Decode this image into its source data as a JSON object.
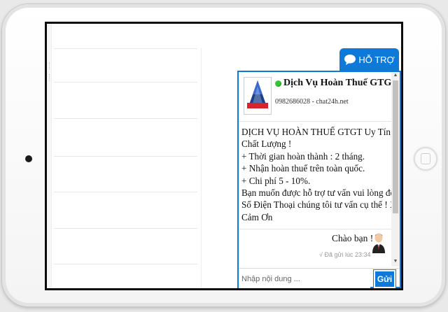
{
  "chat_widget": {
    "tab_label": "HỖ TRỢ",
    "agent": {
      "name": "Dịch Vụ Hoàn Thuế GTGT",
      "phone_line": "0982686028 - chat24h.net",
      "status": "online",
      "status_color": "#32c832"
    },
    "message_lines": [
      "DỊCH VỤ HOÀN THUẾ GTGT Uy Tín -",
      "Chất Lượng !",
      "+ Thời gian hoàn thành : 2 tháng.",
      "+ Nhận hoàn thuế trên toàn quốc.",
      "+ Chi phí 5 - 10%.",
      "Bạn muốn được hỗ trợ tư vấn vui lòng để lại",
      "Số Điện Thoại chúng tôi tư vấn cụ thể ! Xin",
      "Cảm Ơn"
    ],
    "reply": {
      "text": "Chào bạn !",
      "sent_status": "√ Đã gửi lúc 23:34"
    },
    "input_placeholder": "Nhập nội dung ...",
    "send_label": "Gửi",
    "accent_color": "#0d79d9"
  }
}
